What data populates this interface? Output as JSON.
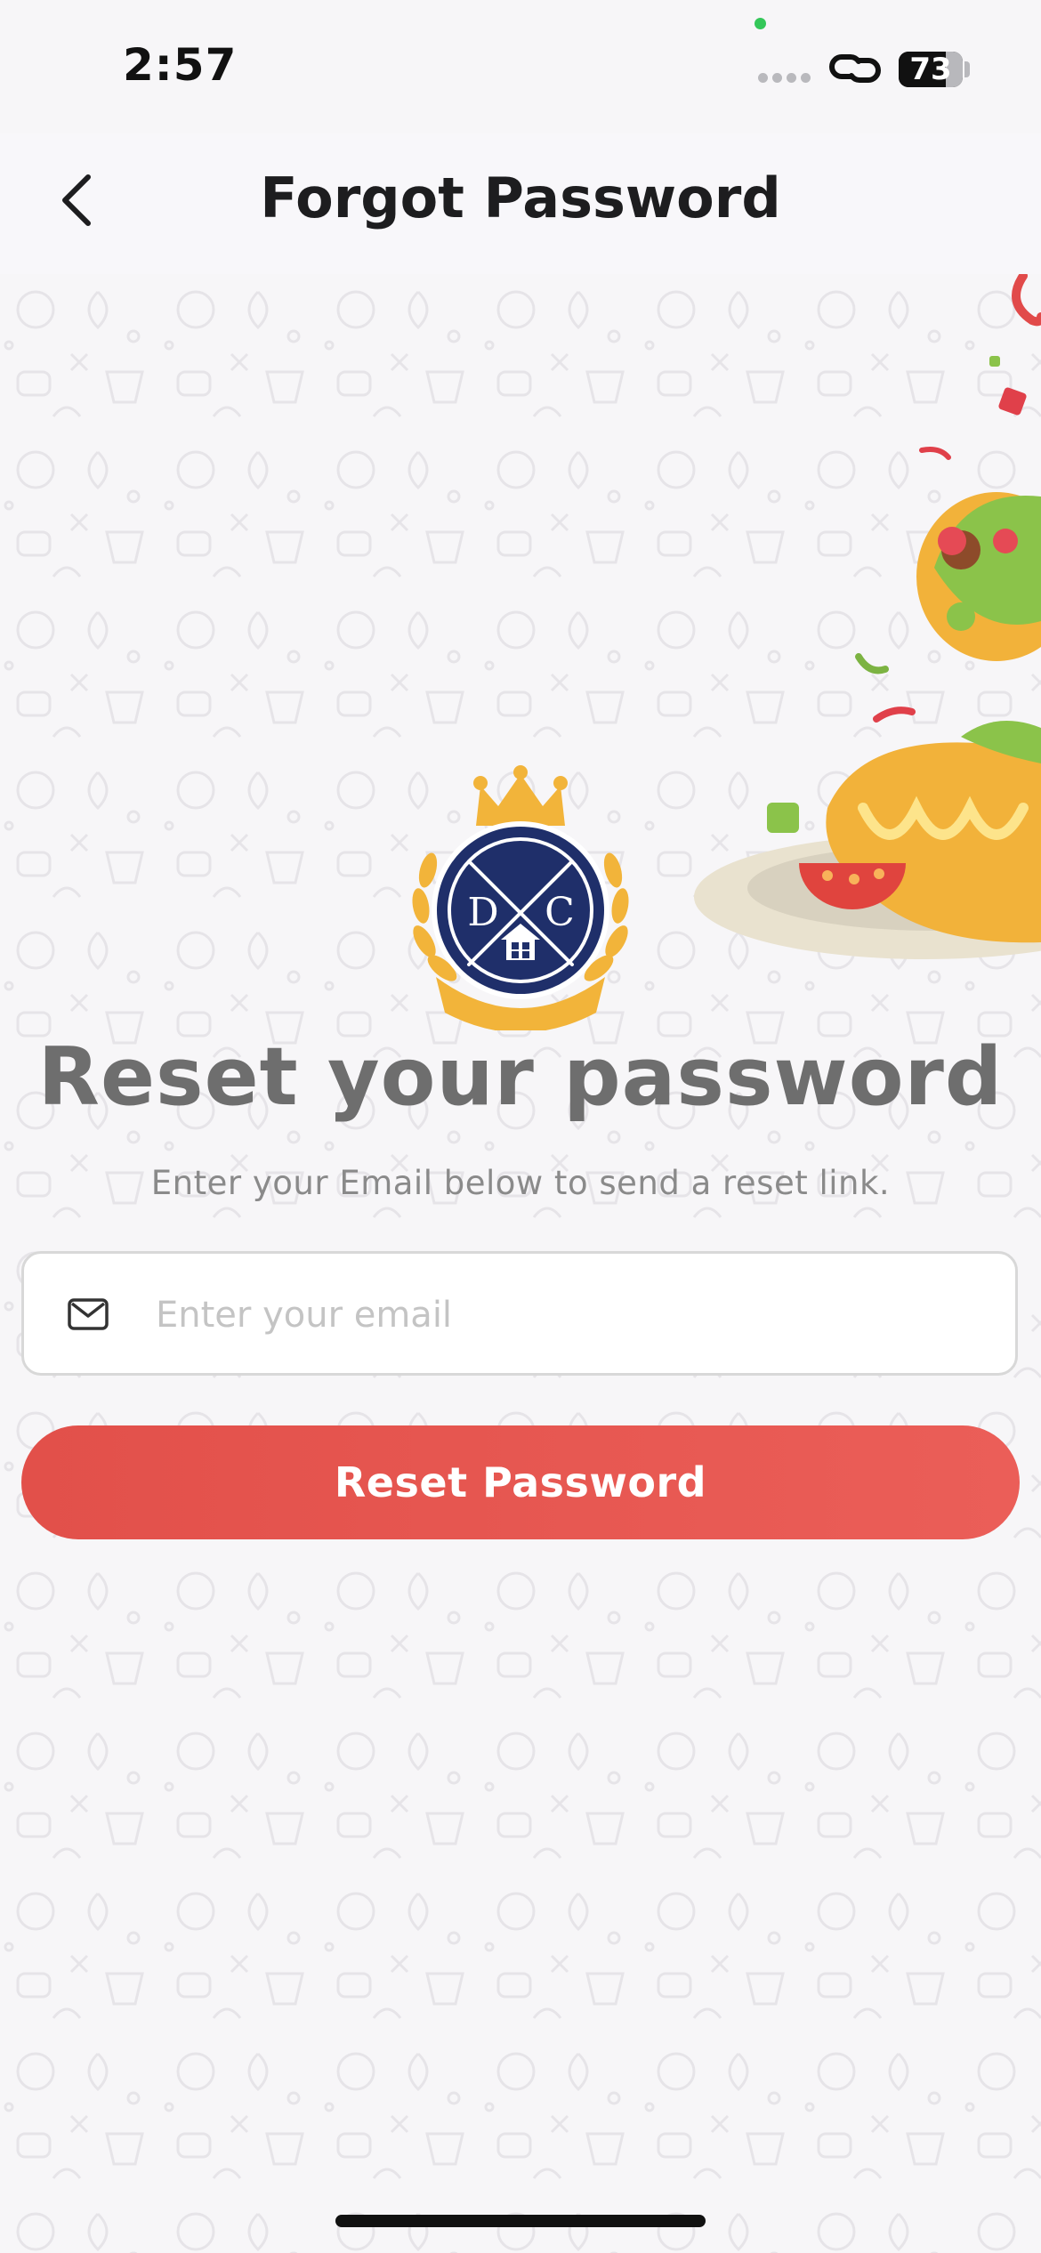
{
  "status_bar": {
    "time": "2:57",
    "battery_level": "73",
    "battery_fraction": 0.73,
    "camera_indicator_color": "#34c759"
  },
  "header": {
    "title": "Forgot Password",
    "back_icon": "chevron-left-icon"
  },
  "main": {
    "heading": "Reset your password",
    "subtitle": "Enter your Email below to send a reset link.",
    "email_field": {
      "value": "",
      "placeholder": "Enter your email",
      "icon": "envelope-icon"
    },
    "reset_button_label": "Reset Password"
  },
  "logo": {
    "letters_left": "D",
    "letters_right": "C"
  },
  "colors": {
    "accent": "#e55650",
    "logo_navy": "#1f2f6a",
    "logo_gold": "#f2b43a",
    "background": "#f7f6f8"
  }
}
